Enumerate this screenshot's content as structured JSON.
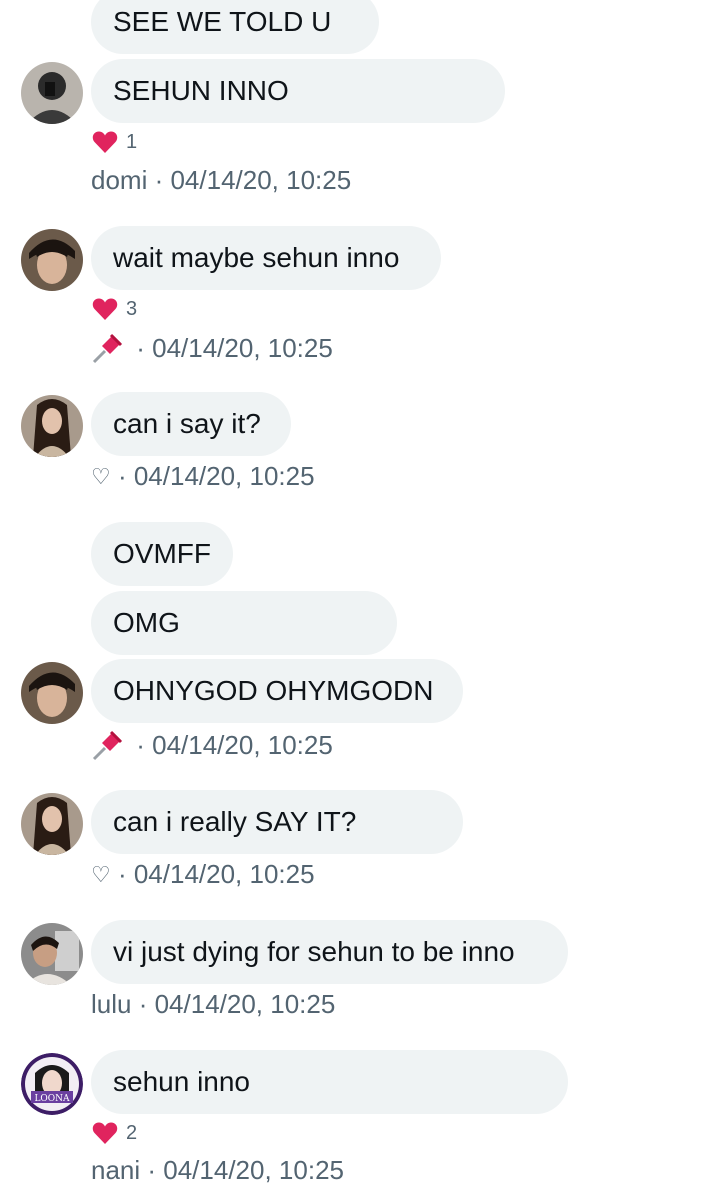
{
  "messages": {
    "m1": {
      "b1": "SEE WE TOLD U",
      "b2": "SEHUN INNO",
      "likes": "1",
      "sender": "domi",
      "time": "04/14/20, 10:25"
    },
    "m2": {
      "b1": "wait maybe sehun inno",
      "likes": "3",
      "time": "04/14/20, 10:25"
    },
    "m3": {
      "b1": "can i say it?",
      "like_icon": "♡",
      "time": "04/14/20, 10:25"
    },
    "m4": {
      "b1": "OVMFF",
      "b2": "OMG",
      "b3": "OHNYGOD OHYMGODN",
      "time": "04/14/20, 10:25"
    },
    "m5": {
      "b1": "can i really SAY IT?",
      "like_icon": "♡",
      "time": "04/14/20, 10:25"
    },
    "m6": {
      "b1": "vi just dying for sehun to be inno",
      "sender": "lulu",
      "time": "04/14/20, 10:25"
    },
    "m7": {
      "b1": "sehun inno",
      "likes": "2",
      "sender": "nani",
      "time": "04/14/20, 10:25"
    }
  },
  "separator": " · ",
  "icons": {
    "reaction": "heart-icon",
    "pinned": "pushpin-icon",
    "unliked": "heart-outline-icon"
  },
  "colors": {
    "bubble": "#eff3f4",
    "meta": "#536471",
    "heart": "#f91880"
  }
}
